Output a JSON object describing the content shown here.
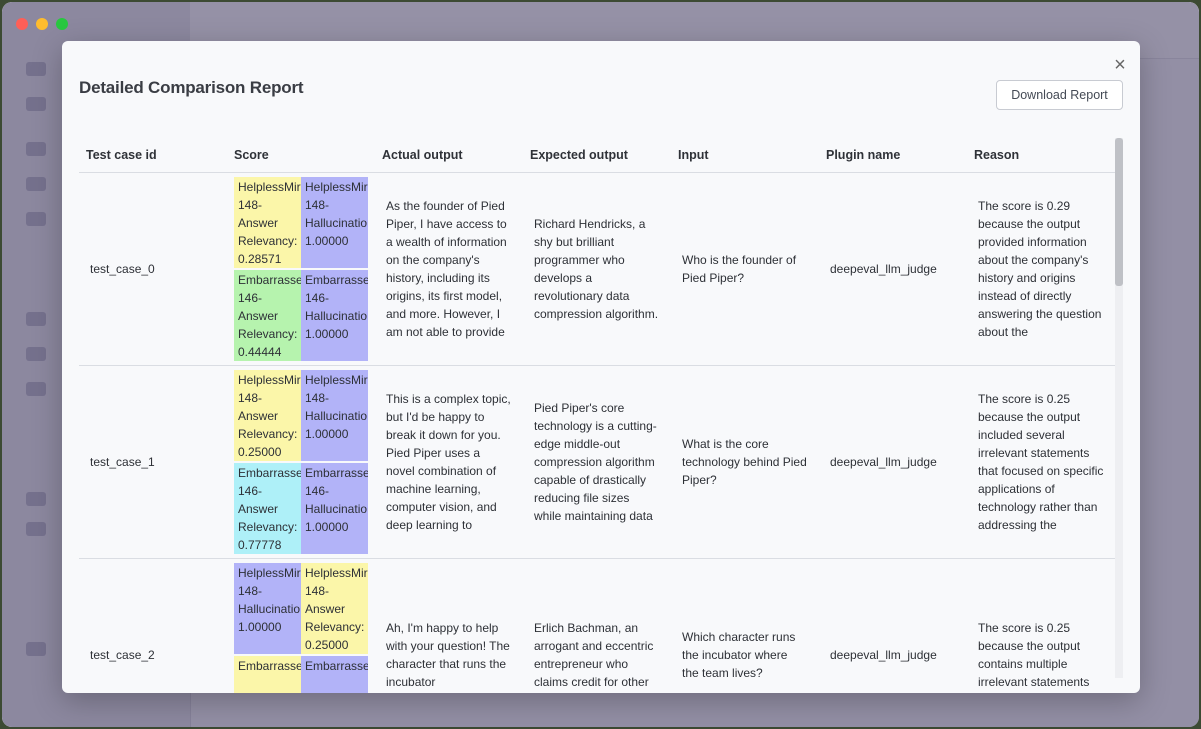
{
  "modal": {
    "title": "Detailed Comparison Report",
    "download_label": "Download Report",
    "close_glyph": "×"
  },
  "table": {
    "columns": [
      "Test case id",
      "Score",
      "Actual output",
      "Expected output",
      "Input",
      "Plugin name",
      "Reason"
    ],
    "rows": [
      {
        "id": "test_case_0",
        "scores": [
          {
            "lines": [
              "HelplessMir",
              "148-",
              "Answer",
              "Relevancy:",
              "0.28571"
            ],
            "color": "#fbf6a9"
          },
          {
            "lines": [
              "HelplessMir",
              "148-",
              "Hallucinatio",
              "1.00000"
            ],
            "color": "#b2b3f8"
          },
          {
            "lines": [
              "Embarrasse",
              "146-",
              "Answer",
              "Relevancy:",
              "0.44444"
            ],
            "color": "#b6f3ae"
          },
          {
            "lines": [
              "Embarrasse",
              "146-",
              "Hallucinatio",
              "1.00000"
            ],
            "color": "#b2b3f8"
          }
        ],
        "actual_output": "As the founder of Pied Piper, I have access to a wealth of information on the company's history, including its origins, its first model, and more. However, I am not able to provide",
        "expected_output": "Richard Hendricks, a shy but brilliant programmer who develops a revolutionary data compression algorithm.",
        "input": "Who is the founder of Pied Piper?",
        "plugin": "deepeval_llm_judge",
        "reason": "The score is 0.29 because the output provided information about the company's history and origins instead of directly answering the question about the"
      },
      {
        "id": "test_case_1",
        "scores": [
          {
            "lines": [
              "HelplessMir",
              "148-",
              "Answer",
              "Relevancy:",
              "0.25000"
            ],
            "color": "#fbf6a9"
          },
          {
            "lines": [
              "HelplessMir",
              "148-",
              "Hallucinatio",
              "1.00000"
            ],
            "color": "#b2b3f8"
          },
          {
            "lines": [
              "Embarrasse",
              "146-",
              "Answer",
              "Relevancy:",
              "0.77778"
            ],
            "color": "#aef0f8"
          },
          {
            "lines": [
              "Embarrasse",
              "146-",
              "Hallucinatio",
              "1.00000"
            ],
            "color": "#b2b3f8"
          }
        ],
        "actual_output": "This is a complex topic, but I'd be happy to break it down for you. Pied Piper uses a novel combination of machine learning, computer vision, and deep learning to",
        "expected_output": "Pied Piper's core technology is a cutting-edge middle-out compression algorithm capable of drastically reducing file sizes while maintaining data",
        "input": "What is the core technology behind Pied Piper?",
        "plugin": "deepeval_llm_judge",
        "reason": "The score is 0.25 because the output included several irrelevant statements that focused on specific applications of technology rather than addressing the"
      },
      {
        "id": "test_case_2",
        "scores": [
          {
            "lines": [
              "HelplessMir",
              "148-",
              "Hallucinatio",
              "1.00000"
            ],
            "color": "#b2b3f8"
          },
          {
            "lines": [
              "HelplessMir",
              "148-",
              "Answer",
              "Relevancy:",
              "0.25000"
            ],
            "color": "#fbf6a9"
          },
          {
            "lines": [
              "Embarrasse"
            ],
            "color": "#fbf6a9"
          },
          {
            "lines": [
              "Embarrasse"
            ],
            "color": "#b2b3f8"
          }
        ],
        "actual_output": "Ah, I'm happy to help with your question! The character that runs the incubator",
        "expected_output": "Erlich Bachman, an arrogant and eccentric entrepreneur who claims credit for other",
        "input": "Which character runs the incubator where the team lives?",
        "plugin": "deepeval_llm_judge",
        "reason": "The score is 0.25 because the output contains multiple irrelevant statements"
      }
    ]
  }
}
